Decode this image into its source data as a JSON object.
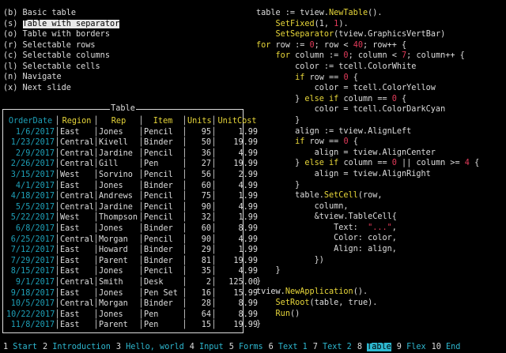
{
  "menu": [
    {
      "key": "(b)",
      "label": "Basic table"
    },
    {
      "key": "(s)",
      "label": "Table with separator",
      "selected": true
    },
    {
      "key": "(o)",
      "label": "Table with borders"
    },
    {
      "key": "(r)",
      "label": "Selectable rows"
    },
    {
      "key": "(c)",
      "label": "Selectable columns"
    },
    {
      "key": "(l)",
      "label": "Selectable cells"
    },
    {
      "key": "(n)",
      "label": "Navigate"
    },
    {
      "key": "(x)",
      "label": "Next slide"
    }
  ],
  "table": {
    "title": "Table",
    "headers": [
      "OrderDate",
      "Region",
      "Rep",
      "Item",
      "Units",
      "UnitCost"
    ],
    "rows": [
      [
        "1/6/2017",
        "East",
        "Jones",
        "Pencil",
        "95",
        "1.99"
      ],
      [
        "1/23/2017",
        "Central",
        "Kivell",
        "Binder",
        "50",
        "19.99"
      ],
      [
        "2/9/2017",
        "Central",
        "Jardine",
        "Pencil",
        "36",
        "4.99"
      ],
      [
        "2/26/2017",
        "Central",
        "Gill",
        "Pen",
        "27",
        "19.99"
      ],
      [
        "3/15/2017",
        "West",
        "Sorvino",
        "Pencil",
        "56",
        "2.99"
      ],
      [
        "4/1/2017",
        "East",
        "Jones",
        "Binder",
        "60",
        "4.99"
      ],
      [
        "4/18/2017",
        "Central",
        "Andrews",
        "Pencil",
        "75",
        "1.99"
      ],
      [
        "5/5/2017",
        "Central",
        "Jardine",
        "Pencil",
        "90",
        "4.99"
      ],
      [
        "5/22/2017",
        "West",
        "Thompson",
        "Pencil",
        "32",
        "1.99"
      ],
      [
        "6/8/2017",
        "East",
        "Jones",
        "Binder",
        "60",
        "8.99"
      ],
      [
        "6/25/2017",
        "Central",
        "Morgan",
        "Pencil",
        "90",
        "4.99"
      ],
      [
        "7/12/2017",
        "East",
        "Howard",
        "Binder",
        "29",
        "1.99"
      ],
      [
        "7/29/2017",
        "East",
        "Parent",
        "Binder",
        "81",
        "19.99"
      ],
      [
        "8/15/2017",
        "East",
        "Jones",
        "Pencil",
        "35",
        "4.99"
      ],
      [
        "9/1/2017",
        "Central",
        "Smith",
        "Desk",
        "2",
        "125.00"
      ],
      [
        "9/18/2017",
        "East",
        "Jones",
        "Pen Set",
        "16",
        "15.99"
      ],
      [
        "10/5/2017",
        "Central",
        "Morgan",
        "Binder",
        "28",
        "8.99"
      ],
      [
        "10/22/2017",
        "East",
        "Jones",
        "Pen",
        "64",
        "8.99"
      ],
      [
        "11/8/2017",
        "East",
        "Parent",
        "Pen",
        "15",
        "19.99"
      ]
    ]
  },
  "code_lines": [
    "table := tview.NewTable().",
    "    SetFixed(1, 1).",
    "    SetSeparator(tview.GraphicsVertBar)",
    "for row := 0; row < 40; row++ {",
    "    for column := 0; column < 7; column++ {",
    "        color := tcell.ColorWhite",
    "        if row == 0 {",
    "            color = tcell.ColorYellow",
    "        } else if column == 0 {",
    "            color = tcell.ColorDarkCyan",
    "        }",
    "        align := tview.AlignLeft",
    "        if row == 0 {",
    "            align = tview.AlignCenter",
    "        } else if column == 0 || column >= 4 {",
    "            align = tview.AlignRight",
    "        }",
    "        table.SetCell(row,",
    "            column,",
    "            &tview.TableCell{",
    "                Text:  \"...\",",
    "                Color: color,",
    "                Align: align,",
    "            })",
    "    }",
    "}",
    "tview.NewApplication().",
    "    SetRoot(table, true).",
    "    Run()",
    "}"
  ],
  "status_tabs": [
    {
      "num": "1",
      "label": "Start"
    },
    {
      "num": "2",
      "label": "Introduction"
    },
    {
      "num": "3",
      "label": "Hello, world"
    },
    {
      "num": "4",
      "label": "Input"
    },
    {
      "num": "5",
      "label": "Forms"
    },
    {
      "num": "6",
      "label": "Text 1"
    },
    {
      "num": "7",
      "label": "Text 2"
    },
    {
      "num": "8",
      "label": "Table",
      "active": true
    },
    {
      "num": "9",
      "label": "Flex"
    },
    {
      "num": "10",
      "label": "End"
    }
  ],
  "colors": {
    "fixed_column": "#1ea0b8",
    "header": "#e8d73a",
    "keyword": "#e8d73a",
    "number": "#e23b5a",
    "tab_label": "#2eb8d0"
  }
}
